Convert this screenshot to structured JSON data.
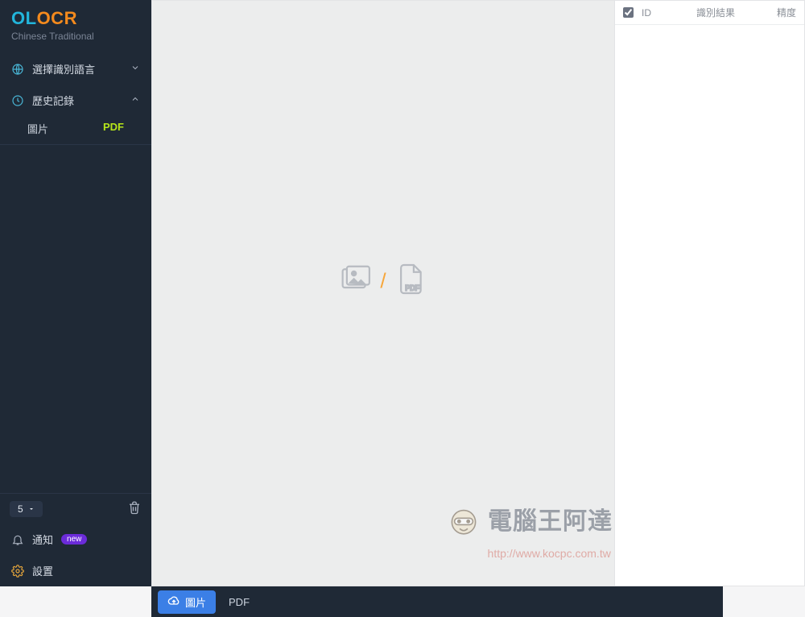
{
  "brand": {
    "logo_left": "OL",
    "logo_right": "OCR",
    "lang_caption": "Chinese Traditional"
  },
  "sidebar": {
    "select_lang": "選擇識別語言",
    "history": "歷史記錄",
    "history_tabs": {
      "image": "圖片",
      "pdf": "PDF"
    },
    "page_number": "5",
    "notify": "通知",
    "notify_badge": "new",
    "settings": "設置"
  },
  "results": {
    "col_id": "ID",
    "col_text": "識別結果",
    "col_acc": "精度"
  },
  "bottombar": {
    "upload_image": "圖片",
    "pdf": "PDF"
  },
  "watermark": {
    "text": "電腦王阿達",
    "url": "http://www.kocpc.com.tw"
  }
}
